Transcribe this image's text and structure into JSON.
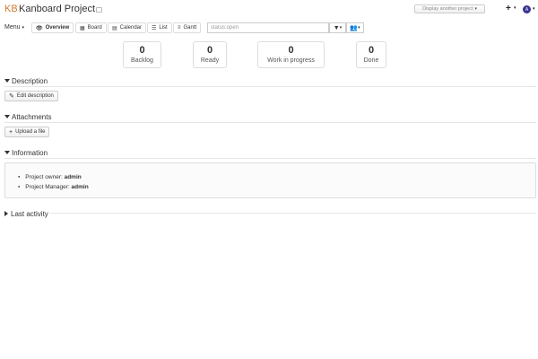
{
  "header": {
    "logo": "KB",
    "title": "Kanboard Project",
    "project_select_placeholder": "Display another project",
    "plus_label": "+",
    "avatar_initial": "A"
  },
  "toolbar": {
    "menu_label": "Menu",
    "views": [
      {
        "label": "Overview",
        "icon": "eye-icon"
      },
      {
        "label": "Board",
        "icon": "grid-icon"
      },
      {
        "label": "Calendar",
        "icon": "calendar-icon"
      },
      {
        "label": "List",
        "icon": "list-icon"
      },
      {
        "label": "Gantt",
        "icon": "sliders-icon"
      }
    ],
    "active_view": "Overview",
    "search_value": "status:open"
  },
  "stats": [
    {
      "value": "0",
      "label": "Backlog"
    },
    {
      "value": "0",
      "label": "Ready"
    },
    {
      "value": "0",
      "label": "Work in progress"
    },
    {
      "value": "0",
      "label": "Done"
    }
  ],
  "sections": {
    "description": {
      "title": "Description",
      "button": "Edit description"
    },
    "attachments": {
      "title": "Attachments",
      "button": "Upload a file"
    },
    "information": {
      "title": "Information",
      "owner_label": "Project owner:",
      "owner_value": "admin",
      "manager_label": "Project Manager:",
      "manager_value": "admin"
    },
    "last_activity": {
      "title": "Last activity"
    }
  }
}
